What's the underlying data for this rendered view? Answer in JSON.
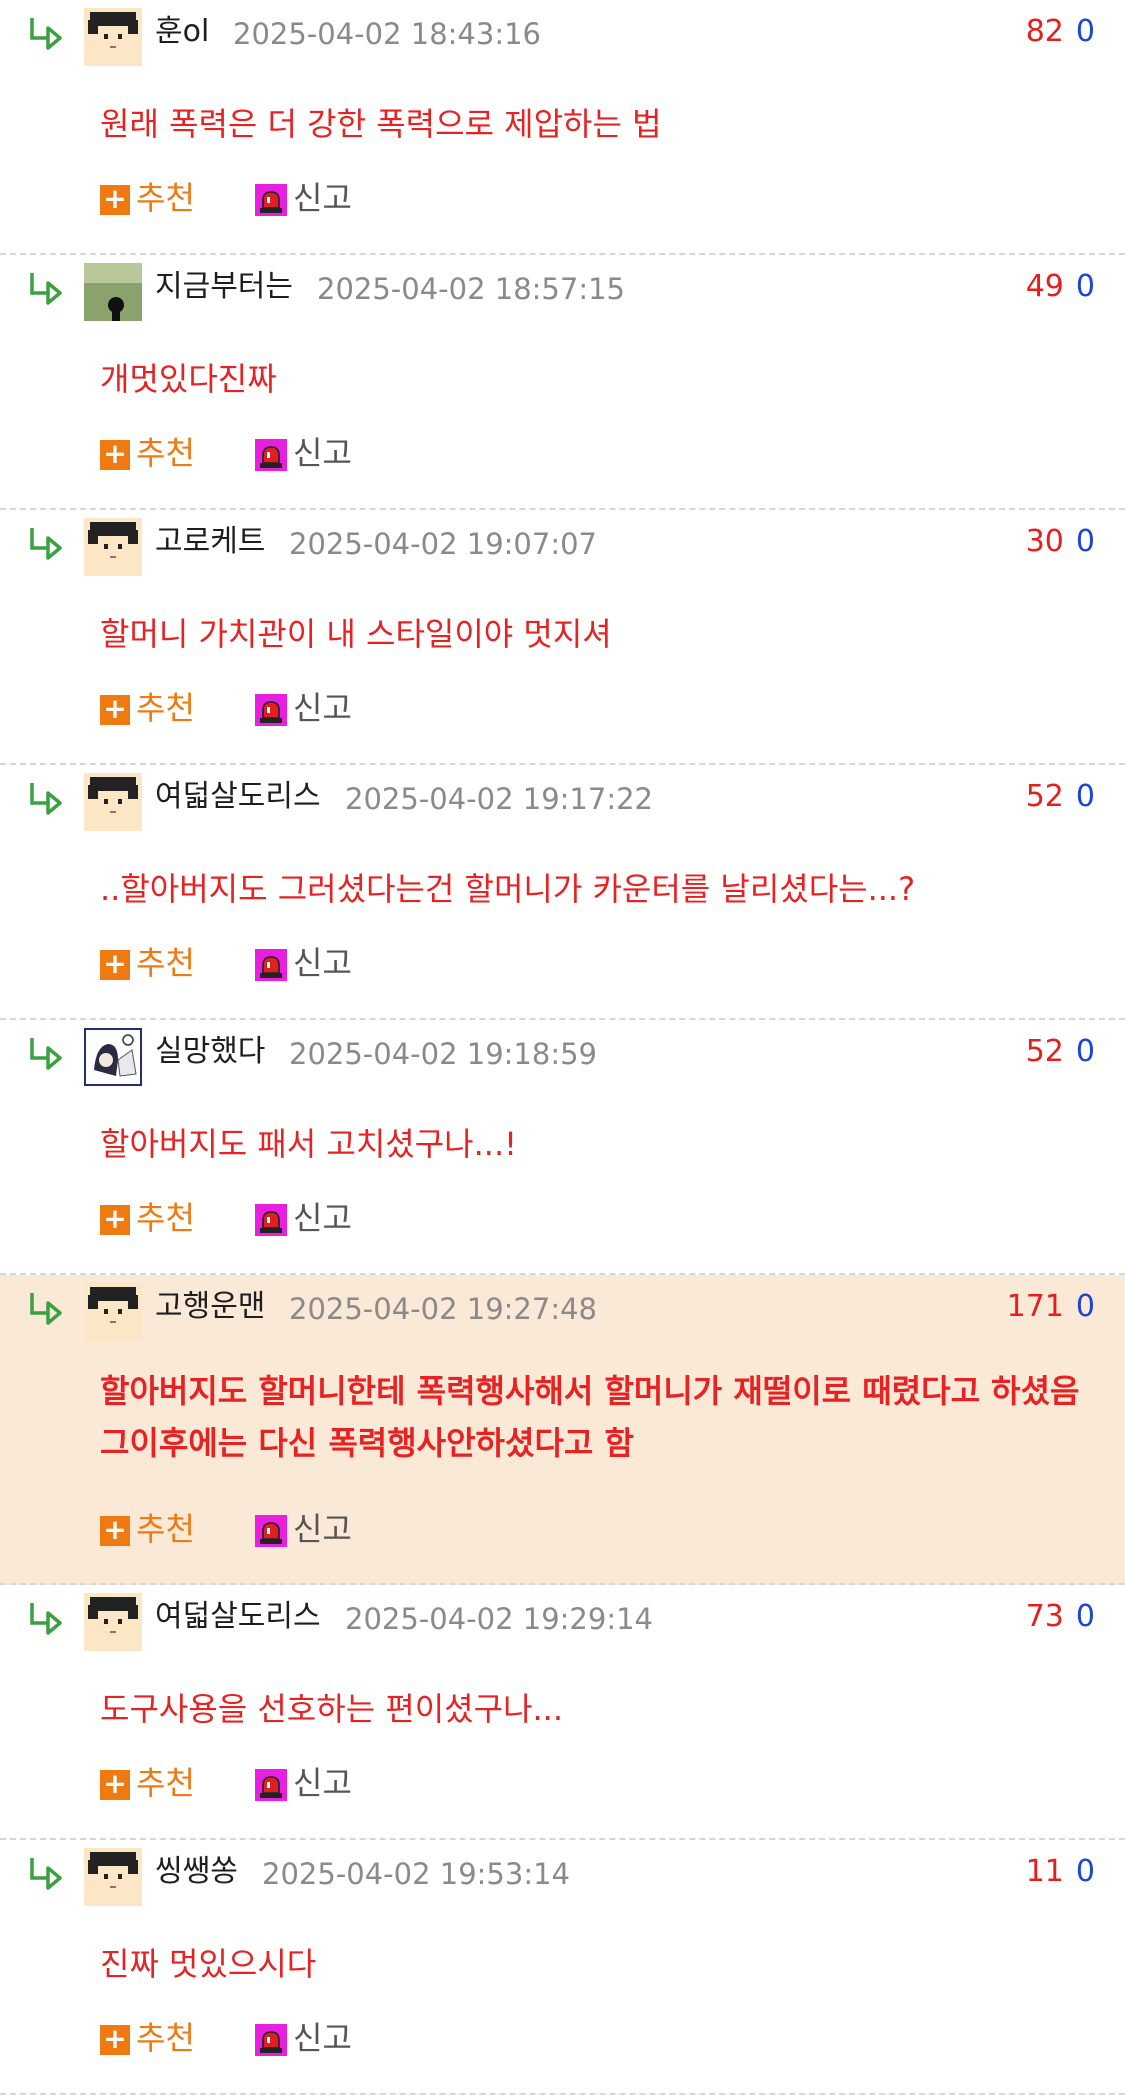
{
  "comments": [
    {
      "nick": "훈ol",
      "date": "2025-04-02 18:43:16",
      "up": "82",
      "down": "0",
      "text": "원래 폭력은 더 강한 폭력으로 제압하는 법",
      "avatar": "generic-avatar",
      "best": false
    },
    {
      "nick": "지금부터는",
      "date": "2025-04-02 18:57:15",
      "up": "49",
      "down": "0",
      "text": "개멋있다진짜",
      "avatar": "photo-avatar",
      "best": false
    },
    {
      "nick": "고로케트",
      "date": "2025-04-02 19:07:07",
      "up": "30",
      "down": "0",
      "text": "할머니 가치관이 내 스타일이야 멋지셔",
      "avatar": "generic-avatar",
      "best": false
    },
    {
      "nick": "여덟살도리스",
      "date": "2025-04-02 19:17:22",
      "up": "52",
      "down": "0",
      "text": "..할아버지도 그러셨다는건 할머니가 카운터를 날리셨다는...?",
      "avatar": "generic-avatar",
      "best": false
    },
    {
      "nick": "실망했다",
      "date": "2025-04-02 19:18:59",
      "up": "52",
      "down": "0",
      "text": "할아버지도 패서 고치셨구나...!",
      "avatar": "art-avatar",
      "best": false
    },
    {
      "nick": "고행운맨",
      "date": "2025-04-02 19:27:48",
      "up": "171",
      "down": "0",
      "text": "할아버지도 할머니한테 폭력행사해서 할머니가 재떨이로 때렸다고 하셨음 그이후에는 다신 폭력행사안하셨다고 함",
      "avatar": "generic-avatar",
      "best": true
    },
    {
      "nick": "여덟살도리스",
      "date": "2025-04-02 19:29:14",
      "up": "73",
      "down": "0",
      "text": "도구사용을 선호하는 편이셨구나...",
      "avatar": "generic-avatar",
      "best": false
    },
    {
      "nick": "씽쌩쏭",
      "date": "2025-04-02 19:53:14",
      "up": "11",
      "down": "0",
      "text": "진짜 멋있으시다",
      "avatar": "generic-avatar",
      "best": false
    }
  ],
  "actions": {
    "recommend_label": "추천",
    "recommend_icon": "+",
    "report_label": "신고"
  },
  "colors": {
    "best_bg": "#fbe9d8",
    "text": "#e62222",
    "upvote": "#e61e1e",
    "downvote": "#1a45d8",
    "recommend": "#f07a12",
    "report_icon": "#e81ee0",
    "reply_arrow": "#3aa040"
  }
}
